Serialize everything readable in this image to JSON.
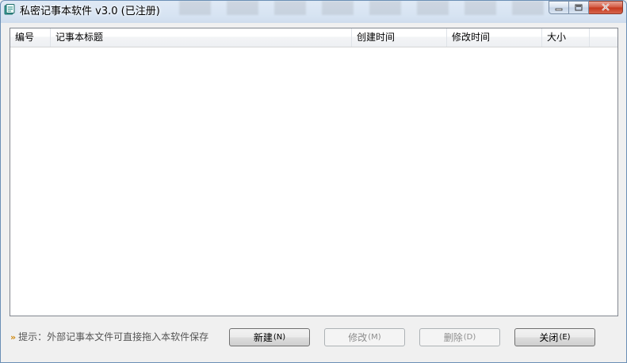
{
  "window": {
    "title": "私密记事本软件 v3.0 (已注册)",
    "icon": "notebook-icon"
  },
  "caption_buttons": {
    "minimize_icon": "minimize-icon",
    "maximize_icon": "maximize-icon",
    "close_icon": "close-icon"
  },
  "list": {
    "columns": [
      {
        "label": "编号"
      },
      {
        "label": "记事本标题"
      },
      {
        "label": "创建时间"
      },
      {
        "label": "修改时间"
      },
      {
        "label": "大小"
      }
    ],
    "rows": []
  },
  "hint": {
    "icon": "double-chevron-right-icon",
    "text": "提示：外部记事本文件可直接拖入本软件保存"
  },
  "buttons": {
    "new": {
      "label": "新建",
      "accel": "(N)",
      "enabled": true
    },
    "edit": {
      "label": "修改",
      "accel": "(M)",
      "enabled": false
    },
    "delete": {
      "label": "删除",
      "accel": "(D)",
      "enabled": false
    },
    "close": {
      "label": "关闭",
      "accel": "(E)",
      "enabled": true
    }
  },
  "colors": {
    "title_bar": "#d6e3f2",
    "close_button": "#c4371c",
    "hint_icon": "#d08a12"
  }
}
